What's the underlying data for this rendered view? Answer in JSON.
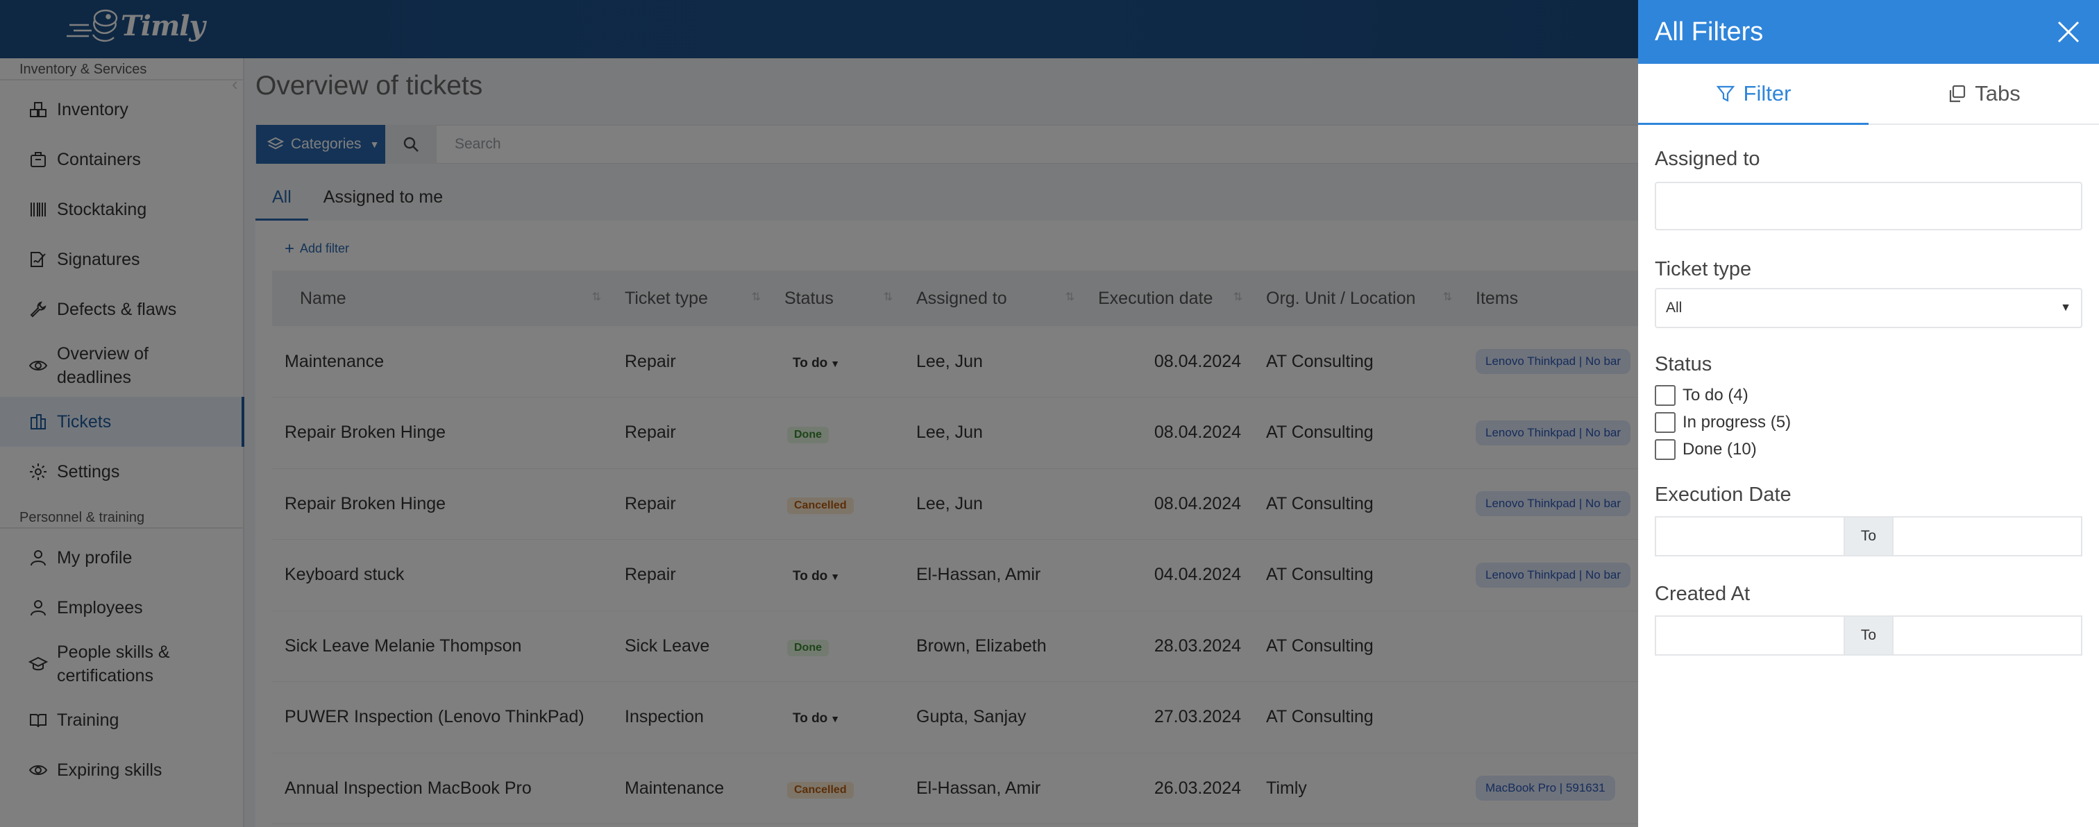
{
  "brand": {
    "logo_text": "Timly"
  },
  "sidebar": {
    "section_inventory": "Inventory & Services",
    "inventory_items": [
      {
        "label": "Inventory",
        "icon": "boxes-icon"
      },
      {
        "label": "Containers",
        "icon": "container-icon"
      },
      {
        "label": "Stocktaking",
        "icon": "barcode-icon"
      },
      {
        "label": "Signatures",
        "icon": "signature-icon"
      },
      {
        "label": "Defects & flaws",
        "icon": "wrench-icon"
      },
      {
        "label": "Overview of deadlines",
        "icon": "eye-icon"
      },
      {
        "label": "Tickets",
        "icon": "ticket-icon",
        "active": true
      },
      {
        "label": "Settings",
        "icon": "gear-icon"
      }
    ],
    "section_personnel": "Personnel & training",
    "personnel_items": [
      {
        "label": "My profile",
        "icon": "user-icon"
      },
      {
        "label": "Employees",
        "icon": "user-icon"
      },
      {
        "label": "People skills & certifications",
        "icon": "graduation-cap-icon"
      },
      {
        "label": "Training",
        "icon": "book-icon"
      },
      {
        "label": "Expiring skills",
        "icon": "eye-icon"
      }
    ]
  },
  "main": {
    "title": "Overview of tickets",
    "categories_label": "Categories",
    "search_placeholder": "Search",
    "tabs": [
      {
        "label": "All",
        "active": true
      },
      {
        "label": "Assigned to me"
      }
    ],
    "add_filter": "Add filter",
    "columns": [
      "Name",
      "Ticket type",
      "Status",
      "Assigned to",
      "Execution date",
      "Org. Unit / Location",
      "Items"
    ],
    "rows": [
      {
        "name": "Maintenance",
        "type": "Repair",
        "status": "To do",
        "status_kind": "todo",
        "assigned": "Lee, Jun",
        "date": "08.04.2024",
        "org": "AT Consulting",
        "item": "Lenovo Thinkpad | No bar"
      },
      {
        "name": "Repair Broken Hinge",
        "type": "Repair",
        "status": "Done",
        "status_kind": "done",
        "assigned": "Lee, Jun",
        "date": "08.04.2024",
        "org": "AT Consulting",
        "item": "Lenovo Thinkpad | No bar"
      },
      {
        "name": "Repair Broken Hinge",
        "type": "Repair",
        "status": "Cancelled",
        "status_kind": "cancelled",
        "assigned": "Lee, Jun",
        "date": "08.04.2024",
        "org": "AT Consulting",
        "item": "Lenovo Thinkpad | No bar"
      },
      {
        "name": "Keyboard stuck",
        "type": "Repair",
        "status": "To do",
        "status_kind": "todo",
        "assigned": "El-Hassan, Amir",
        "date": "04.04.2024",
        "org": "AT Consulting",
        "item": "Lenovo Thinkpad | No bar"
      },
      {
        "name": "Sick Leave Melanie Thompson",
        "type": "Sick Leave",
        "status": "Done",
        "status_kind": "done",
        "assigned": "Brown, Elizabeth",
        "date": "28.03.2024",
        "org": "AT Consulting",
        "item": ""
      },
      {
        "name": "PUWER Inspection (Lenovo ThinkPad)",
        "type": "Inspection",
        "status": "To do",
        "status_kind": "todo",
        "assigned": "Gupta, Sanjay",
        "date": "27.03.2024",
        "org": "AT Consulting",
        "item": ""
      },
      {
        "name": "Annual Inspection MacBook Pro",
        "type": "Maintenance",
        "status": "Cancelled",
        "status_kind": "cancelled",
        "assigned": "El-Hassan, Amir",
        "date": "26.03.2024",
        "org": "Timly",
        "item": "MacBook Pro | 591631"
      }
    ]
  },
  "filters": {
    "title": "All Filters",
    "tab_filter": "Filter",
    "tab_tabs": "Tabs",
    "assigned_label": "Assigned to",
    "ticket_type_label": "Ticket type",
    "ticket_type_value": "All",
    "status_label": "Status",
    "status_options": [
      "To do (4)",
      "In progress (5)",
      "Done (10)"
    ],
    "exec_date_label": "Execution Date",
    "created_label": "Created At",
    "to_label": "To"
  },
  "colors": {
    "primary": "#2867ad",
    "drawer_header": "#2f85da",
    "topbar": "#1e558f"
  }
}
